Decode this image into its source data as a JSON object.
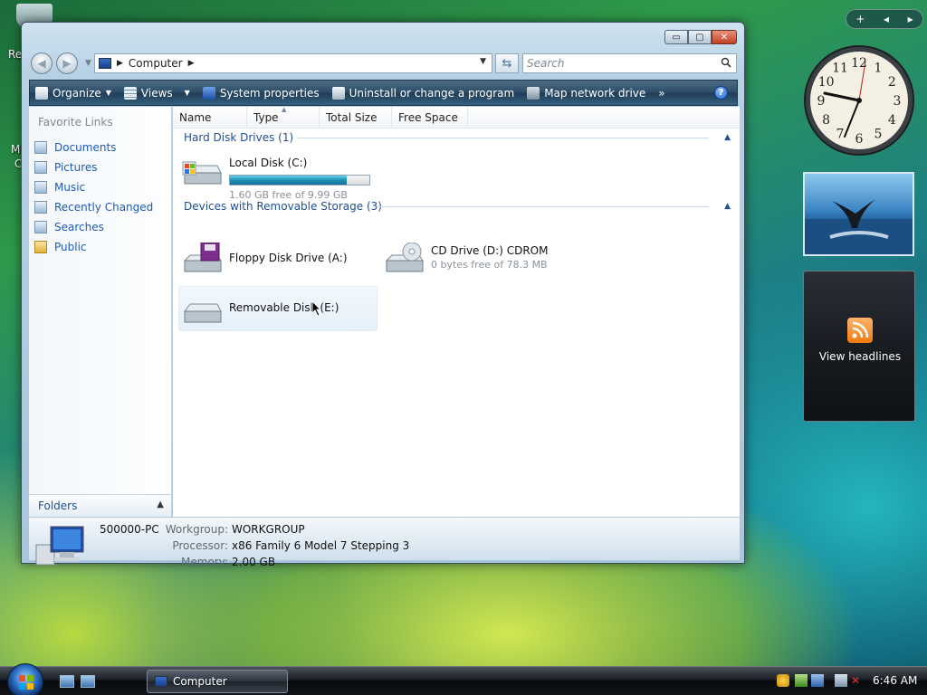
{
  "desktop": {
    "partial_texts": [
      "Re",
      "M",
      "C"
    ]
  },
  "window": {
    "title_buttons": {
      "minimize": "▭",
      "maximize": "▢",
      "close": "✕"
    },
    "address": {
      "location": "Computer"
    },
    "search": {
      "placeholder": "Search"
    },
    "toolbar": {
      "organize": "Organize",
      "views": "Views",
      "system_properties": "System properties",
      "uninstall": "Uninstall or change a program",
      "map_drive": "Map network drive",
      "overflow": "»",
      "help": "?"
    },
    "left_pane": {
      "favorite_links_title": "Favorite Links",
      "links": [
        "Documents",
        "Pictures",
        "Music",
        "Recently Changed",
        "Searches",
        "Public"
      ],
      "folders_label": "Folders"
    },
    "columns": [
      "Name",
      "Type",
      "Total Size",
      "Free Space"
    ],
    "groups": {
      "hard_disk": "Hard Disk Drives (1)",
      "removable": "Devices with Removable Storage (3)"
    },
    "drives": {
      "local_c": {
        "name": "Local Disk (C:)",
        "free": "1.60 GB free of 9.99 GB",
        "used_fraction": 0.84
      },
      "floppy": {
        "name": "Floppy Disk Drive (A:)"
      },
      "cd": {
        "name": "CD Drive (D:) CDROM",
        "free": "0 bytes free of 78.3 MB"
      },
      "removable_e": {
        "name": "Removable Disk (E:)"
      }
    },
    "details": {
      "computer_name": "500000-PC",
      "workgroup_label": "Workgroup:",
      "workgroup": "WORKGROUP",
      "processor_label": "Processor:",
      "processor": "x86 Family 6 Model 7 Stepping 3",
      "memory_label": "Memory:",
      "memory": "2.00 GB"
    }
  },
  "sidebar": {
    "controls": [
      "+",
      "◂",
      "▸"
    ],
    "clock_numbers": [
      "12",
      "1",
      "2",
      "3",
      "4",
      "5",
      "6",
      "7",
      "8",
      "9",
      "10",
      "11"
    ],
    "feed_text": "View headlines"
  },
  "taskbar": {
    "task_label": "Computer",
    "time": "6:46 AM"
  }
}
